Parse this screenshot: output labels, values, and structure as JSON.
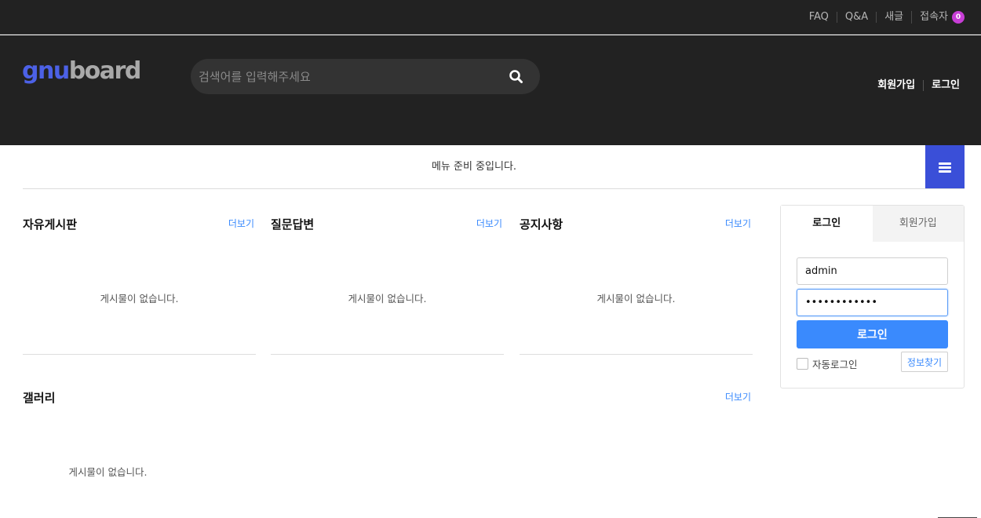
{
  "topbar": {
    "links": [
      {
        "label": "FAQ"
      },
      {
        "label": "Q&A"
      },
      {
        "label": "새글"
      },
      {
        "label": "접속자",
        "badge": "0"
      }
    ]
  },
  "header": {
    "logo": {
      "part1": "gnu",
      "part2": "board"
    },
    "search": {
      "placeholder": "검색어를 입력해주세요",
      "icon": "search-icon"
    },
    "links": [
      "회원가입",
      "로그인"
    ]
  },
  "nav": {
    "message": "메뉴 준비 중입니다.",
    "menu_icon": "hamburger-icon"
  },
  "boards": [
    {
      "title": "자유게시판",
      "more": "더보기",
      "empty": "게시물이 없습니다."
    },
    {
      "title": "질문답변",
      "more": "더보기",
      "empty": "게시물이 없습니다."
    },
    {
      "title": "공지사항",
      "more": "더보기",
      "empty": "게시물이 없습니다."
    }
  ],
  "gallery": {
    "title": "갤러리",
    "more": "더보기",
    "empty": "게시물이 없습니다."
  },
  "login": {
    "tabs": [
      "로그인",
      "회원가입"
    ],
    "username": "admin",
    "password": "••••••••••••",
    "submit": "로그인",
    "auto_login": "자동로그인",
    "find": "정보찾기"
  },
  "colors": {
    "accent": "#3a8afd",
    "brand": "#4c61e6",
    "menu_button": "#3a4fd8",
    "header_bg": "#222222",
    "badge": "#c73ed6"
  }
}
